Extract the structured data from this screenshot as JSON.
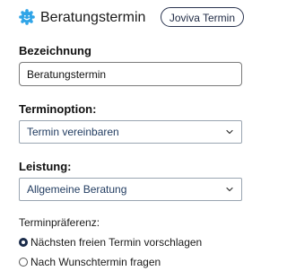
{
  "header": {
    "title": "Beratungstermin",
    "button_label": "Joviva Termin",
    "logo_icon": "gear-badge-icon"
  },
  "colors": {
    "brand": "#2fa4e7",
    "accent": "#1a2b4a"
  },
  "form": {
    "bezeichnung": {
      "label": "Bezeichnung",
      "value": "Beratungstermin"
    },
    "terminoption": {
      "label": "Terminoption:",
      "selected": "Termin vereinbaren"
    },
    "leistung": {
      "label": "Leistung:",
      "selected": "Allgemeine Beratung"
    },
    "terminpraeferenz": {
      "label": "Terminpräferenz:",
      "options": [
        {
          "label": "Nächsten freien Termin vorschlagen",
          "checked": true
        },
        {
          "label": "Nach Wunschtermin fragen",
          "checked": false
        }
      ]
    }
  }
}
